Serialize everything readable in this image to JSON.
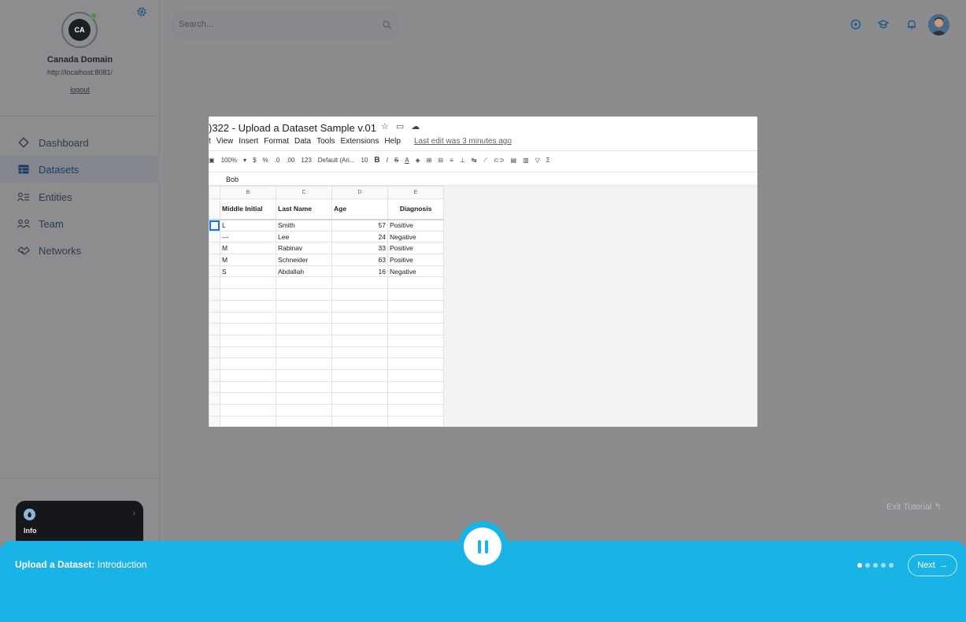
{
  "org": {
    "initials": "CA",
    "name": "Canada Domain",
    "url": "http://localhost:8081/",
    "logout": "logout"
  },
  "nav": [
    {
      "label": "Dashboard",
      "icon": "diamond-icon",
      "active": false
    },
    {
      "label": "Datasets",
      "icon": "table-icon",
      "active": true
    },
    {
      "label": "Entities",
      "icon": "entities-icon",
      "active": false
    },
    {
      "label": "Team",
      "icon": "team-icon",
      "active": false
    },
    {
      "label": "Networks",
      "icon": "handshake-icon",
      "active": false
    }
  ],
  "info_card": {
    "label": "Info"
  },
  "search": {
    "placeholder": "Search..."
  },
  "sheet": {
    "title": ")322 - Upload a Dataset Sample v.01",
    "menu": [
      "t",
      "View",
      "Insert",
      "Format",
      "Data",
      "Tools",
      "Extensions",
      "Help"
    ],
    "last_edit": "Last edit was 3 minutes ago",
    "toolbar": {
      "zoom": "100%",
      "currency": "$",
      "percent": "%",
      "dec_less": ".0",
      "dec_more": ".00",
      "format": "123",
      "font": "Default (Ari...",
      "size": "10",
      "bold": "B",
      "italic": "I",
      "strike": "S",
      "color": "A"
    },
    "formula_value": "Bob",
    "columns": [
      "B",
      "C",
      "D",
      "E"
    ],
    "headers": [
      "Middle Initial",
      "Last Name",
      "Age",
      "Diagnosis"
    ],
    "rows": [
      [
        "L",
        "Smith",
        "57",
        "Positive"
      ],
      [
        "---",
        "Lee",
        "24",
        "Negative"
      ],
      [
        "M",
        "Rabinav",
        "33",
        "Positive"
      ],
      [
        "M",
        "Schneider",
        "63",
        "Positive"
      ],
      [
        "S",
        "Abdallah",
        "16",
        "Negative"
      ]
    ]
  },
  "exit_tutorial": "Exit Tutorial",
  "tutorial": {
    "title": "Upload a Dataset:",
    "step": "Introduction",
    "next": "Next",
    "step_count": 5,
    "current_step": 1
  },
  "colors": {
    "accent": "#1ab3e6",
    "sidebar": "#8d8d90",
    "dark_card": "#16171c"
  }
}
